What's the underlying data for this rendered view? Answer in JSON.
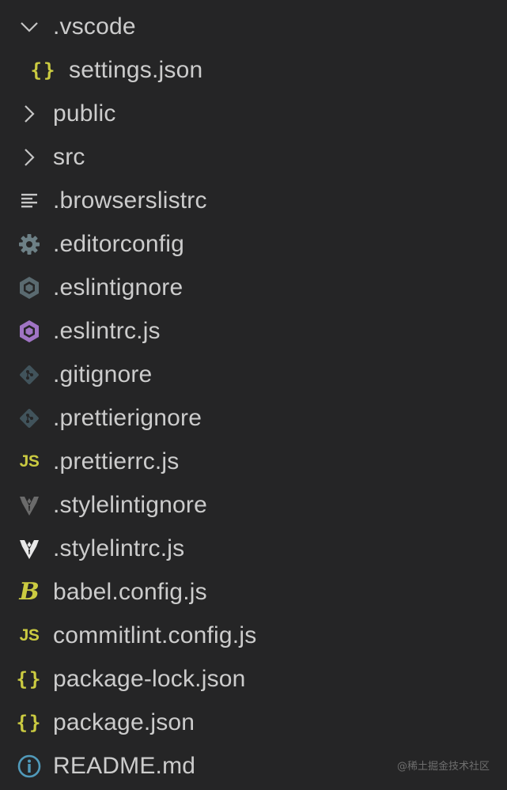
{
  "explorer": {
    "items": [
      {
        "label": ".vscode",
        "icon": "chevron-down-icon"
      },
      {
        "label": "settings.json",
        "icon": "json-braces-icon"
      },
      {
        "label": "public",
        "icon": "chevron-right-icon"
      },
      {
        "label": "src",
        "icon": "chevron-right-icon"
      },
      {
        "label": ".browserslistrc",
        "icon": "text-lines-icon"
      },
      {
        "label": ".editorconfig",
        "icon": "gear-icon"
      },
      {
        "label": ".eslintignore",
        "icon": "eslint-icon"
      },
      {
        "label": ".eslintrc.js",
        "icon": "eslint-icon"
      },
      {
        "label": ".gitignore",
        "icon": "git-icon"
      },
      {
        "label": ".prettierignore",
        "icon": "git-icon"
      },
      {
        "label": ".prettierrc.js",
        "icon": "javascript-icon"
      },
      {
        "label": ".stylelintignore",
        "icon": "stylelint-icon"
      },
      {
        "label": ".stylelintrc.js",
        "icon": "stylelint-icon"
      },
      {
        "label": "babel.config.js",
        "icon": "babel-icon"
      },
      {
        "label": "commitlint.config.js",
        "icon": "javascript-icon"
      },
      {
        "label": "package-lock.json",
        "icon": "json-braces-icon"
      },
      {
        "label": "package.json",
        "icon": "json-braces-icon"
      },
      {
        "label": "README.md",
        "icon": "info-icon"
      }
    ],
    "js_glyph": "JS",
    "brace_glyph": "{}",
    "babel_glyph": "B"
  },
  "watermark": "@稀土掘金技术社区",
  "colors": {
    "background": "#252526",
    "text": "#cccccc",
    "chevron": "#c5c5c5",
    "yellow": "#cbcb41",
    "eslint_purple": "#a074c4",
    "grey_icon": "#6d8086",
    "stylelint_dim": "#9a9a9a",
    "info": "#519aba"
  }
}
